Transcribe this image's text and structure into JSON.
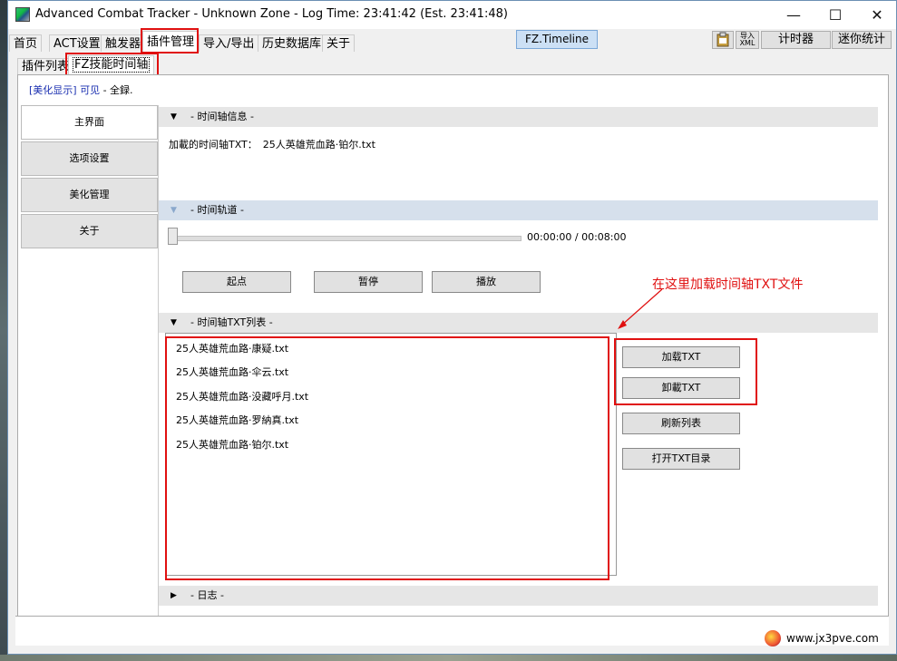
{
  "window": {
    "title": "Advanced Combat Tracker - Unknown Zone - Log Time: 23:41:42 (Est. 23:41:48)",
    "minimize": "—",
    "maximize": "☐",
    "close": "✕"
  },
  "menu": {
    "tabs": [
      "首页",
      "ACT设置",
      "触发器",
      "插件管理",
      "导入/导出",
      "历史数据库",
      "关于"
    ],
    "plugin_button": "FZ.Timeline",
    "export_xml_line1": "导入",
    "export_xml_line2": "XML",
    "timer_button": "计时器",
    "mini_stats_button": "迷你统计"
  },
  "subtabs": [
    "插件列表",
    "FZ技能时间轴"
  ],
  "status": {
    "prefix": "[美化显示]",
    "visible": " 可见",
    "suffix": " - 全録."
  },
  "nav": [
    "主界面",
    "选项设置",
    "美化管理",
    "关于"
  ],
  "sections": {
    "timeline_info": "- 时间轴信息 -",
    "loaded_label": "加載的时间轴TXT：",
    "loaded_file": "25人英雄荒血路·铂尔.txt",
    "track": "- 时间轨道 -",
    "time_display": "00:00:00 / 00:08:00",
    "start_button": "起点",
    "pause_button": "暂停",
    "play_button": "播放",
    "txt_list": "- 时间轴TXT列表 -",
    "log": "- 日志 -"
  },
  "txt_files": [
    "25人英雄荒血路·康疑.txt",
    "25人英雄荒血路·伞云.txt",
    "25人英雄荒血路·没藏呼月.txt",
    "25人英雄荒血路·罗納真.txt",
    "25人英雄荒血路·铂尔.txt"
  ],
  "actions": {
    "load": "加载TXT",
    "unload": "卸載TXT",
    "refresh": "刷新列表",
    "open_dir": "打开TXT目录"
  },
  "annotation": "在这里加载时间轴TXT文件",
  "watermark": "www.jx3pve.com",
  "colors": {
    "highlight": "#e01010",
    "link": "#1a2fb0",
    "plugin_button": "#cce0f5"
  }
}
